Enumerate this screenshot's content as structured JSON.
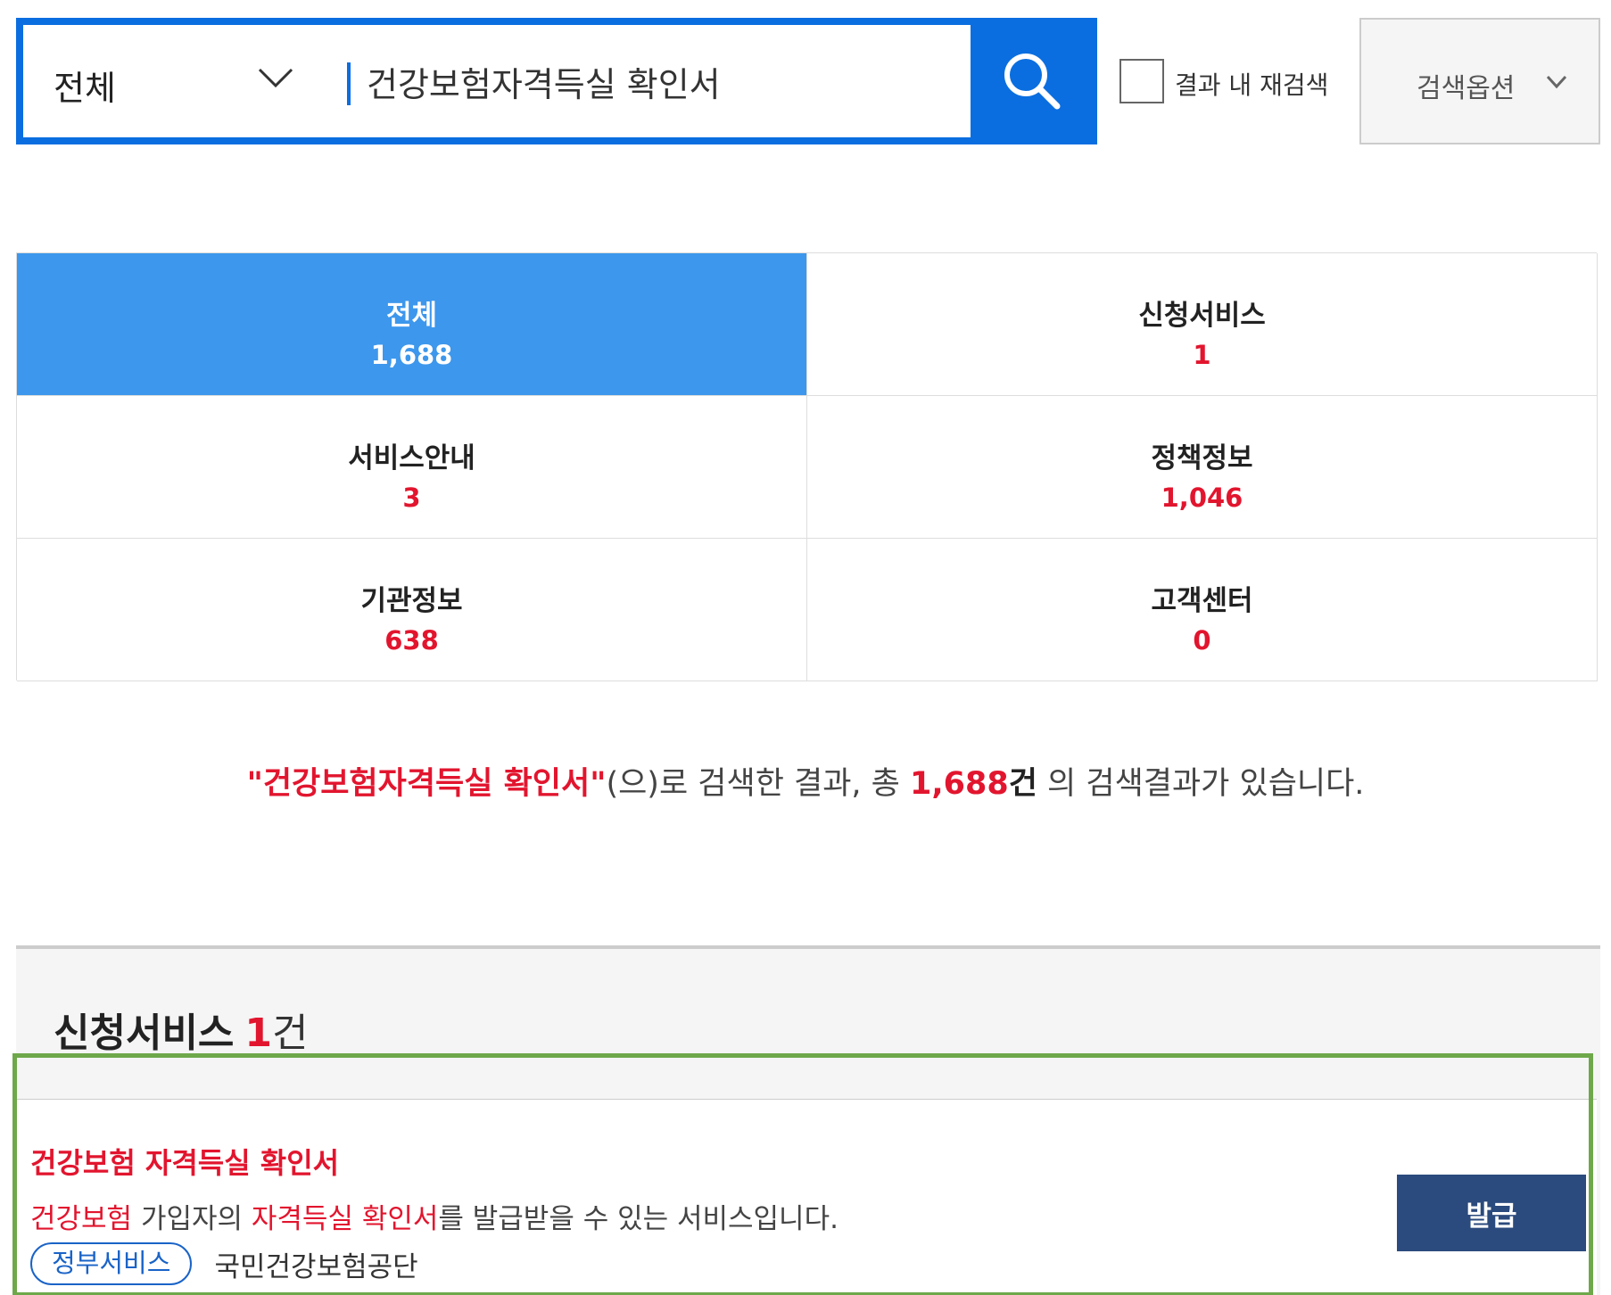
{
  "search": {
    "scope_label": "전체",
    "query_value": "건강보험자격득실 확인서",
    "recheck_label": "결과 내 재검색",
    "options_label": "검색옵션",
    "accent_color": "#0a6ee0"
  },
  "icons": {
    "search": "search-icon",
    "scope_dropdown": "chevron-down-icon",
    "options_dropdown": "chevron-down-icon"
  },
  "tabs": [
    {
      "name": "전체",
      "count": "1,688",
      "active": true
    },
    {
      "name": "신청서비스",
      "count": "1",
      "active": false
    },
    {
      "name": "서비스안내",
      "count": "3",
      "active": false
    },
    {
      "name": "정책정보",
      "count": "1,046",
      "active": false
    },
    {
      "name": "기관정보",
      "count": "638",
      "active": false
    },
    {
      "name": "고객센터",
      "count": "0",
      "active": false
    }
  ],
  "summary": {
    "open_quote": "\"",
    "query": "건강보험자격득실 확인서",
    "close_quote": "\"",
    "mid": "(으)로 검색한 결과, 총 ",
    "total": "1,688",
    "unit": "건",
    "tail": " 의 검색결과가 있습니다."
  },
  "service_section": {
    "title": "신청서비스",
    "count": "1",
    "unit": "건",
    "results": [
      {
        "title": "건강보험 자격득실 확인서",
        "desc_hl1": "건강보험",
        "desc_mid1": " 가입자의 ",
        "desc_hl2": "자격득실 확인서",
        "desc_tail": "를 발급받을 수 있는 서비스입니다.",
        "tag": "정부서비스",
        "agency": "국민건강보험공단",
        "action_label": "발급"
      }
    ]
  },
  "colors": {
    "active_tab": "#3d97ec",
    "count_red": "#e2152e",
    "issue_button": "#2b4a7d",
    "highlight_outline": "#6ea84a"
  }
}
